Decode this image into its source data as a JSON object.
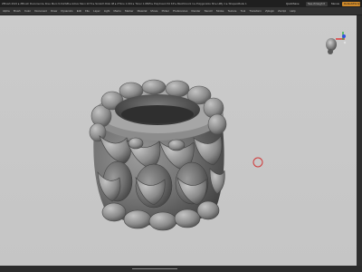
{
  "titlebar": {
    "title": "ZBrush 2021 ▸ ZBrush Document ▸ Free Mem 9.412GB ▸ Active Mem 1173 ▸ Scratch Disk 48 ▸ ZTime 1.031 ▸ Timer 1.0845 ▸ PolyCount 64 KP ▸ MeshCount 1 ▸ Polygonsize 84 ▸ HiBy 1 ▸ ShapesMode 1",
    "quicksave_label": "QuickSave",
    "seethrough_label": "See-through 0",
    "menus_label": "Menus",
    "script_label": "DefaultZScript"
  },
  "menubar": {
    "items": [
      "Alpha",
      "Brush",
      "Color",
      "Document",
      "Draw",
      "Dynamics",
      "Edit",
      "File",
      "Layer",
      "Light",
      "Macro",
      "Marker",
      "Material",
      "Movie",
      "Picker",
      "Preferences",
      "Render",
      "Stencil",
      "Stroke",
      "Texture",
      "Tool",
      "Transform",
      "Zplugin",
      "Zscript",
      "Help"
    ]
  },
  "viewport": {
    "background": "#c8c8c8",
    "model": "sculpted-ring-mesh",
    "cursor": "draw-cursor-circle",
    "gizmo": "navigation-head-gizmo"
  },
  "colors": {
    "accent": "#d08a2a",
    "cursor_ring": "#d03a3a",
    "gizmo_red": "#e03030",
    "gizmo_green": "#30b040",
    "gizmo_blue": "#3050e0"
  }
}
